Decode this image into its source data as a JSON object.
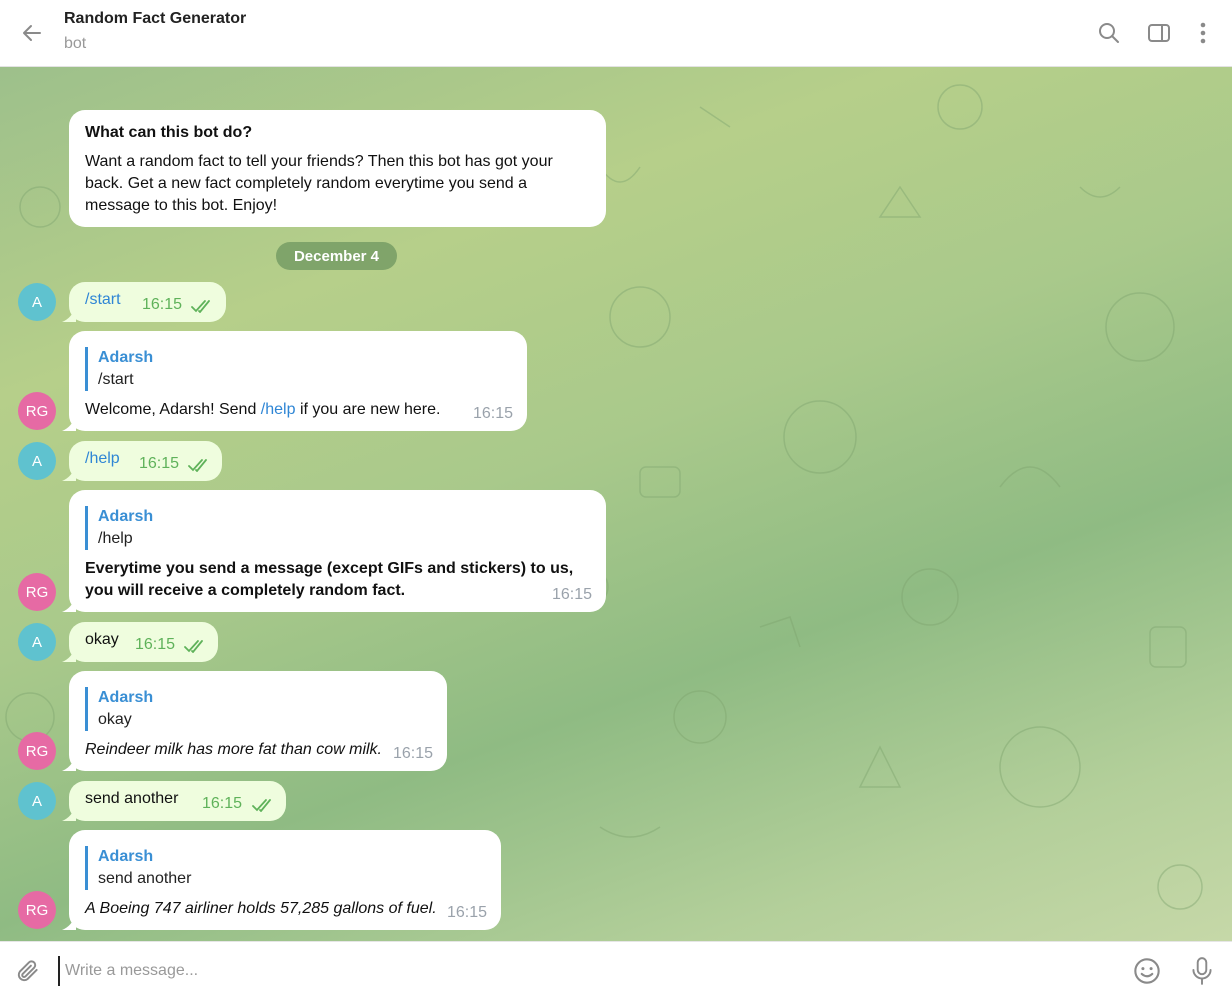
{
  "header": {
    "title": "Random Fact Generator",
    "subtitle": "bot",
    "icons": [
      "back-arrow-icon",
      "search-icon",
      "sidebar-toggle-icon",
      "more-vertical-icon"
    ]
  },
  "intro": {
    "title": "What can this bot do?",
    "text": "Want a random fact to tell your friends? Then this bot has got your back. Get a new fact completely random everytime you send a message to this bot. Enjoy!"
  },
  "date_separator": "December 4",
  "avatars": {
    "user": "A",
    "bot": "RG"
  },
  "messages": [
    {
      "from": "user",
      "text": "/start",
      "time": "16:15"
    },
    {
      "from": "bot",
      "reply_to_name": "Adarsh",
      "reply_to_text": "/start",
      "text_before": "Welcome, Adarsh! Send ",
      "link": "/help",
      "text_after": " if you are new here.",
      "time": "16:15"
    },
    {
      "from": "user",
      "text": "/help",
      "time": "16:15"
    },
    {
      "from": "bot",
      "reply_to_name": "Adarsh",
      "reply_to_text": "/help",
      "line1": "Everytime you send a message (except GIFs and stickers) to us,",
      "line2": "you will receive a completely random fact.",
      "time": "16:15"
    },
    {
      "from": "user",
      "text": "okay",
      "time": "16:15"
    },
    {
      "from": "bot",
      "reply_to_name": "Adarsh",
      "reply_to_text": "okay",
      "text": "Reindeer milk has more fat than cow milk.",
      "time": "16:15"
    },
    {
      "from": "user",
      "text": "send another",
      "time": "16:15"
    },
    {
      "from": "bot",
      "reply_to_name": "Adarsh",
      "reply_to_text": "send another",
      "text": "A Boeing 747 airliner holds 57,285 gallons of fuel.",
      "time": "16:15"
    }
  ],
  "composer": {
    "placeholder": "Write a message...",
    "icons": [
      "paperclip-icon",
      "emoji-icon",
      "microphone-icon"
    ]
  },
  "colors": {
    "incoming_bubble": "#ffffff",
    "outgoing_bubble": "#effdde",
    "link": "#2f86d5",
    "outgoing_time": "#5fb25a",
    "user_avatar": "#5fc2cf",
    "bot_avatar": "#e66aa4"
  }
}
